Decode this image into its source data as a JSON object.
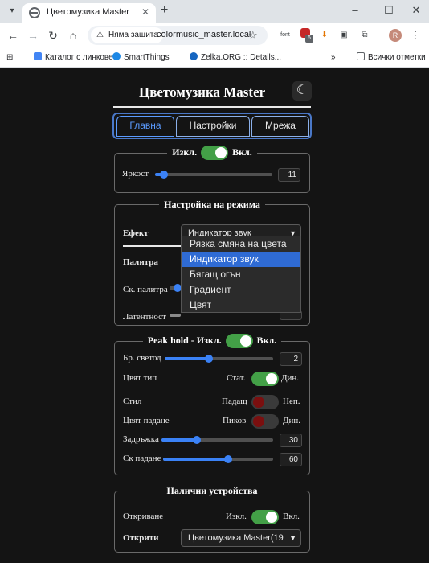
{
  "browser": {
    "tab_title": "Цветомузика Master",
    "security_label": "Няма защита",
    "url": "colormusic_master.local",
    "ext_font": "font",
    "ext_badge": "6",
    "profile_initial": "R",
    "bookmarks": [
      "Каталог с линкове",
      "SmartThings",
      "Zelka.ORG :: Details...",
      "Всички отметки"
    ],
    "bookmarks_overflow": "»"
  },
  "page": {
    "title": "Цветомузика Master",
    "tabs": [
      "Главна",
      "Настройки",
      "Мрежа"
    ],
    "active_tab": "Главна"
  },
  "power": {
    "off_label": "Изкл.",
    "on_label": "Вкл.",
    "state": true,
    "brightness_label": "Яркост",
    "brightness": 11,
    "brightness_max": 255
  },
  "mode": {
    "legend": "Настройка на режима",
    "effect_label": "Ефект",
    "effect_value": "Индикатор звук",
    "effect_options": [
      "Рязка смяна на цвета",
      "Индикатор звук",
      "Бягащ огън",
      "Градиент",
      "Цвят"
    ],
    "palette_label": "Палитра",
    "palette_speed_label": "Ск. палитра",
    "latency_label": "Латентност"
  },
  "peak": {
    "legend_prefix": "Peak hold - Изкл.",
    "legend_suffix": "Вкл.",
    "state": true,
    "led_count_label": "Бр. светод",
    "led_count": 2,
    "led_count_max": 5,
    "color_type_label": "Цвят тип",
    "color_type_left": "Стат.",
    "color_type_right": "Дин.",
    "color_type_state": true,
    "style_label": "Стил",
    "style_left": "Падащ",
    "style_right": "Неп.",
    "style_state": false,
    "fall_color_label": "Цвят падане",
    "fall_color_left": "Пиков",
    "fall_color_right": "Дин.",
    "fall_color_state": false,
    "delay_label": "Задръжка",
    "delay": 30,
    "delay_max": 100,
    "fall_speed_label": "Ск падане",
    "fall_speed": 60,
    "fall_speed_max": 100
  },
  "devices": {
    "legend": "Налични устройства",
    "discovery_label": "Откриване",
    "discovery_left": "Изкл.",
    "discovery_right": "Вкл.",
    "discovery_state": true,
    "found_label": "Открити",
    "found_value": "Цветомузика Master(19"
  },
  "colors": {
    "accent": "#3b82f6",
    "toggle_on": "#43a047",
    "toggle_off_knob": "#b71c1c",
    "page_bg": "#141414",
    "tab_border": "#5b9bff"
  },
  "icons": {
    "theme": "moon-icon",
    "security": "warning-icon",
    "bookmark_star": "star-icon"
  }
}
